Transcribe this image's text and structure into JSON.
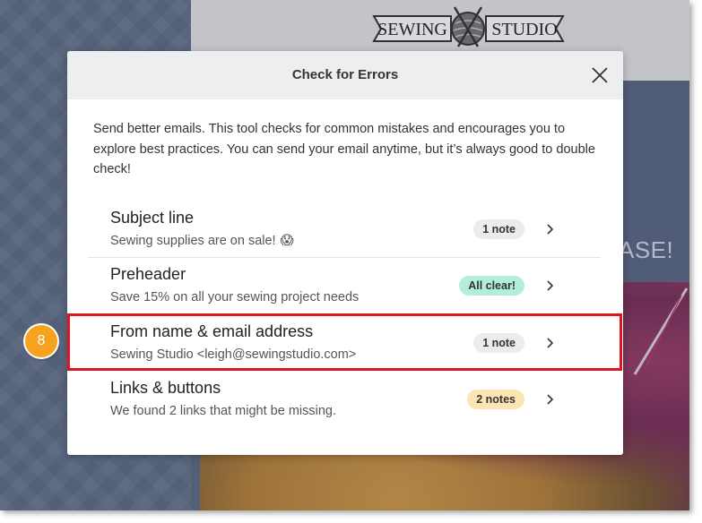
{
  "background": {
    "logo_left": "SEWING",
    "logo_right": "STUDIO",
    "hero_text": "ASE!"
  },
  "modal": {
    "title": "Check for Errors",
    "intro": "Send better emails. This tool checks for common mistakes and encourages you to explore best practices. You can send your email anytime, but it’s always good to double check!",
    "items": [
      {
        "title": "Subject line",
        "subtitle": "Sewing supplies are on sale!",
        "emoji": "😱",
        "badge": "1 note",
        "badge_color": "#ececec"
      },
      {
        "title": "Preheader",
        "subtitle": "Save 15% on all your sewing project needs",
        "badge": "All clear!",
        "badge_color": "#b3eed8"
      },
      {
        "title": "From name & email address",
        "subtitle": "Sewing Studio <leigh@sewingstudio.com>",
        "badge": "1 note",
        "badge_color": "#ececec"
      },
      {
        "title": "Links & buttons",
        "subtitle": "We found 2 links that might be missing.",
        "badge": "2 notes",
        "badge_color": "#fce5b3"
      }
    ]
  },
  "step_marker": "8",
  "colors": {
    "highlight": "#e0141e",
    "step_marker": "#f6a21e"
  }
}
